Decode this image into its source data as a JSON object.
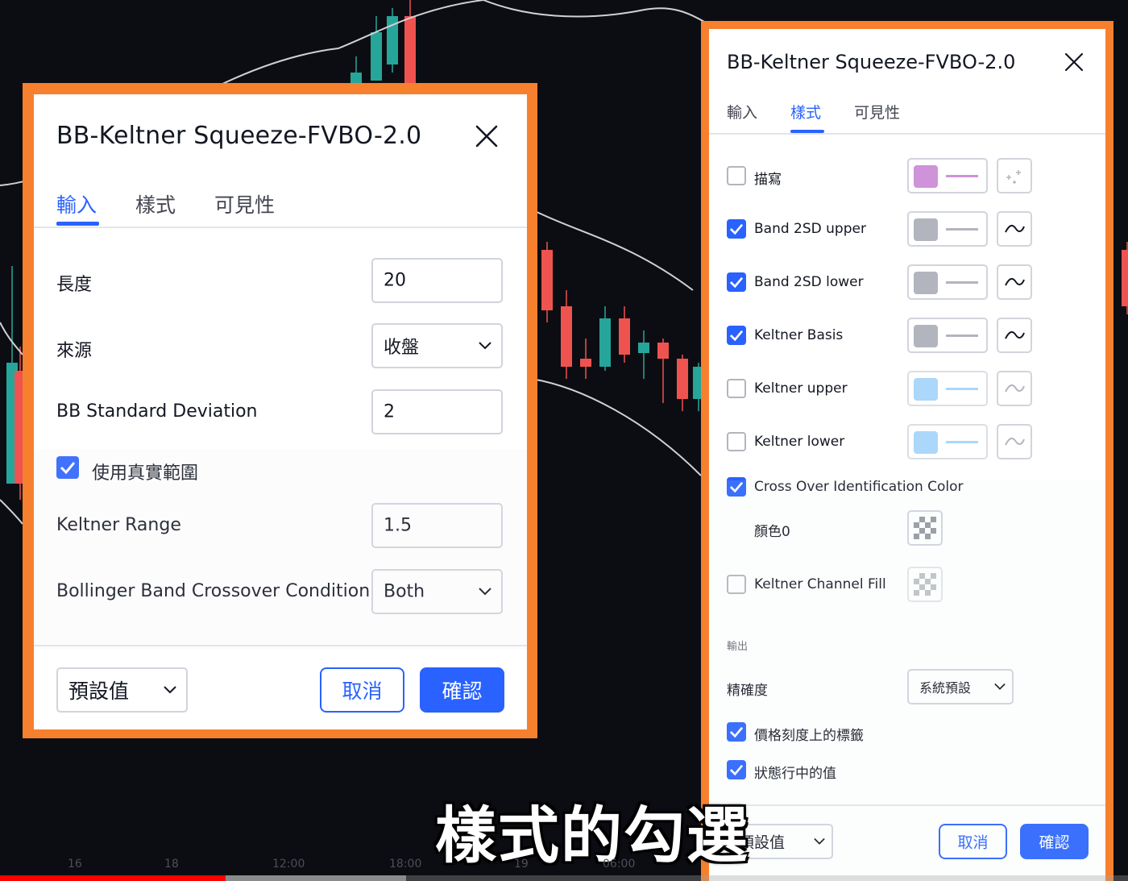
{
  "left_dialog": {
    "title": "BB-Keltner Squeeze-FVBO-2.0",
    "tabs": [
      {
        "label": "輸入",
        "active": true
      },
      {
        "label": "樣式",
        "active": false
      },
      {
        "label": "可見性",
        "active": false
      }
    ],
    "fields": {
      "length": {
        "label": "長度",
        "value": "20"
      },
      "source": {
        "label": "來源",
        "value": "收盤"
      },
      "bb_std": {
        "label": "BB Standard Deviation",
        "value": "2"
      },
      "use_true_range": {
        "label": "使用真實範圍",
        "checked": true
      },
      "keltner_range": {
        "label": "Keltner Range",
        "value": "1.5"
      },
      "crossover": {
        "label": "Bollinger Band Crossover Condition",
        "value": "Both"
      }
    },
    "footer": {
      "defaults_label": "預設值",
      "cancel_label": "取消",
      "ok_label": "確認"
    }
  },
  "right_dialog": {
    "title": "BB-Keltner Squeeze-FVBO-2.0",
    "tabs": [
      {
        "label": "輸入",
        "active": false
      },
      {
        "label": "樣式",
        "active": true
      },
      {
        "label": "可見性",
        "active": false
      }
    ],
    "plots": [
      {
        "label": "描寫",
        "checked": false,
        "color": "#ce93d8"
      },
      {
        "label": "Band 2SD upper",
        "checked": true,
        "color": "#b2b5be"
      },
      {
        "label": "Band 2SD lower",
        "checked": true,
        "color": "#b2b5be"
      },
      {
        "label": "Keltner Basis",
        "checked": true,
        "color": "#b2b5be"
      },
      {
        "label": "Keltner upper",
        "checked": false,
        "color": "#90caf9"
      },
      {
        "label": "Keltner lower",
        "checked": false,
        "color": "#90caf9"
      }
    ],
    "cross_over": {
      "label": "Cross Over Identification Color",
      "checked": true,
      "sub_label": "顏色0"
    },
    "channel_fill": {
      "label": "Keltner Channel Fill",
      "checked": false
    },
    "output": {
      "section_label": "輸出",
      "precision_label": "精確度",
      "precision_value": "系統預設",
      "price_scale_label": {
        "label": "價格刻度上的標籤",
        "checked": true
      },
      "status_line_values": {
        "label": "狀態行中的值",
        "checked": true
      }
    },
    "footer": {
      "defaults_label": "預設值",
      "cancel_label": "取消",
      "ok_label": "確認"
    }
  },
  "subtitle": "樣式的勾選",
  "timeline": {
    "ticks": [
      "16",
      "18",
      "12:00",
      "18:00",
      "19",
      "06:00"
    ],
    "progress_fraction": 0.2,
    "buffered_fraction": 0.36
  },
  "colors": {
    "accent": "#2962ff",
    "frame": "#f7802e",
    "candle_up": "#26a69a",
    "candle_down": "#ef5350"
  }
}
